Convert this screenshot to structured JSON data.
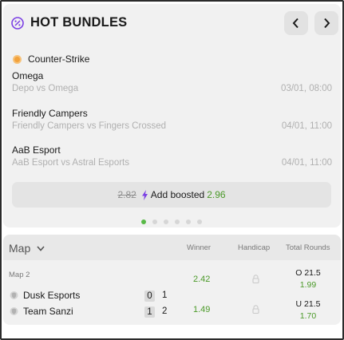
{
  "header": {
    "title": "HOT BUNDLES",
    "icon": "percent-badge-icon"
  },
  "colors": {
    "accent_purple": "#7b3fe4",
    "odds_green": "#4c9a2a",
    "active_dot": "#58b947",
    "sport_orange": "#f2a23c"
  },
  "bundle": {
    "sport": "Counter-Strike",
    "events": [
      {
        "title": "Omega",
        "matchup": "Depo vs Omega",
        "time": "03/01, 08:00"
      },
      {
        "title": "Friendly Campers",
        "matchup": "Friendly Campers vs Fingers Crossed",
        "time": "04/01, 11:00"
      },
      {
        "title": "AaB Esport",
        "matchup": "AaB Esport vs Astral Esports",
        "time": "04/01, 11:00"
      }
    ],
    "old_odds": "2.82",
    "boost_label": "Add boosted",
    "new_odds": "2.96"
  },
  "pagination": {
    "count": 6,
    "active_index": 0
  },
  "market": {
    "map_select": "Map",
    "columns": {
      "winner": "Winner",
      "handicap": "Handicap",
      "total": "Total Rounds"
    },
    "map_label": "Map 2",
    "teams": [
      {
        "name": "Dusk Esports",
        "score_boxed": "0",
        "score_plain": "1",
        "winner_odds": "2.42",
        "total_line": "O 21.5",
        "total_odds": "1.99"
      },
      {
        "name": "Team Sanzi",
        "score_boxed": "1",
        "score_plain": "2",
        "winner_odds": "1.49",
        "total_line": "U 21.5",
        "total_odds": "1.70"
      }
    ]
  }
}
